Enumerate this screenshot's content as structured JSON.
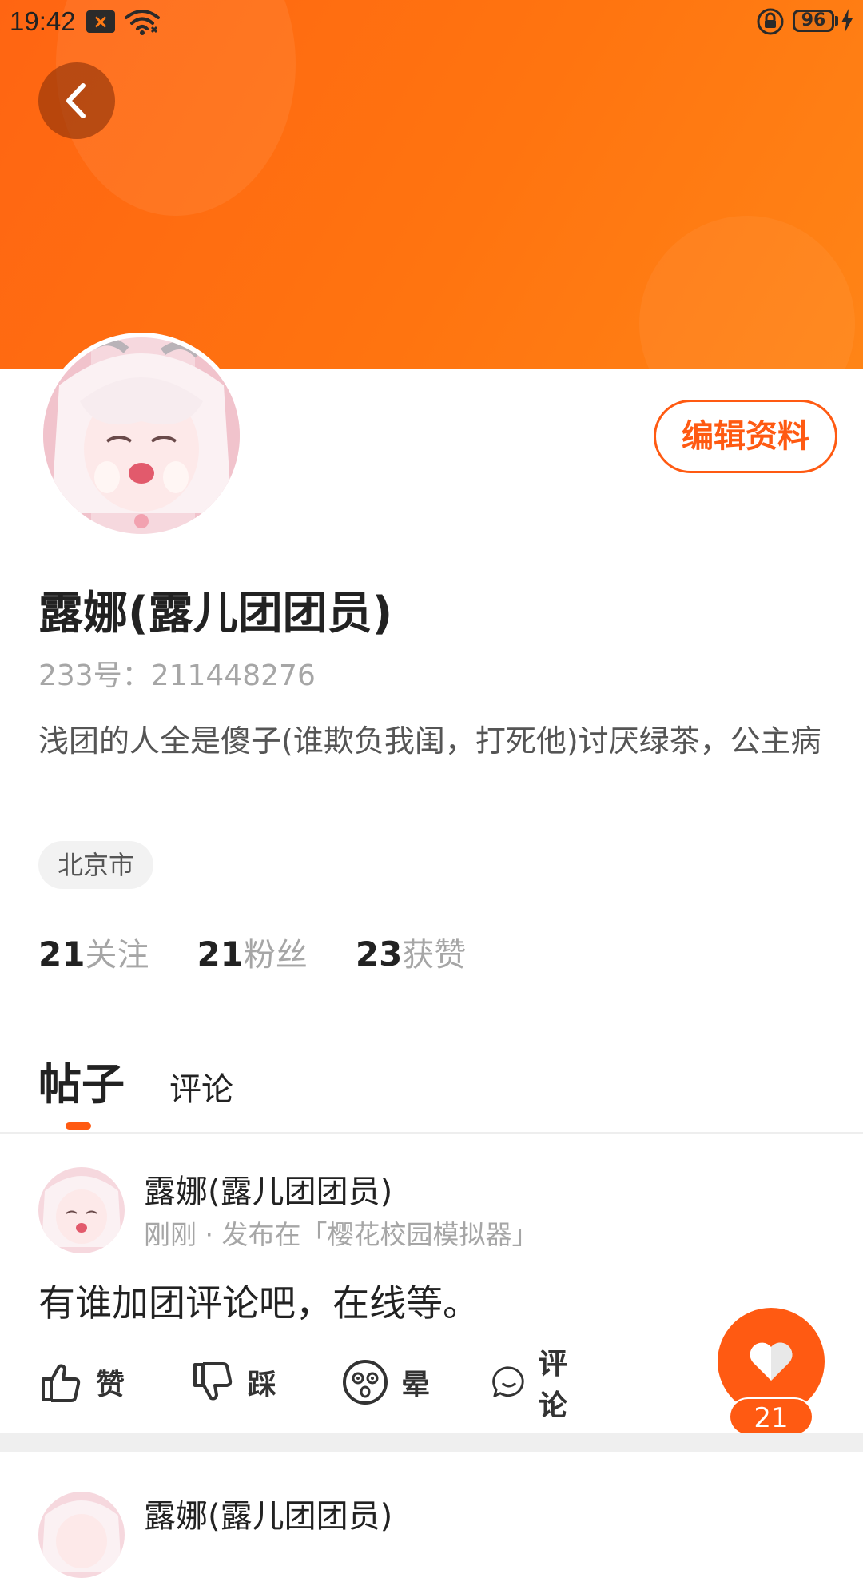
{
  "status_bar": {
    "time": "19:42",
    "battery": "96",
    "icons": [
      "notification-x-icon",
      "wifi-icon",
      "rotation-lock-icon",
      "battery-icon",
      "charging-icon"
    ]
  },
  "header": {
    "back_icon": "chevron-left-icon",
    "banner_color": "#ff7010"
  },
  "profile": {
    "edit_label": "编辑资料",
    "name": "露娜(露儿团团员)",
    "id_text": "233号：211448276",
    "bio": "浅团的人全是傻子(谁欺负我闺，打死他)讨厌绿茶，公主病",
    "location": "北京市",
    "stats": {
      "following_count": "21",
      "following_label": "关注",
      "followers_count": "21",
      "followers_label": "粉丝",
      "likes_count": "23",
      "likes_label": "获赞"
    }
  },
  "tabs": {
    "posts": "帖子",
    "comments": "评论",
    "active": "posts"
  },
  "posts": [
    {
      "author": "露娜(露儿团团员)",
      "meta": "刚刚 · 发布在「樱花校园模拟器」",
      "text": "有谁加团评论吧，在线等。",
      "actions": {
        "like": "赞",
        "dislike": "踩",
        "dizzy": "晕",
        "comment": "评论"
      }
    },
    {
      "author": "露娜(露儿团团员)"
    }
  ],
  "fab": {
    "icon": "heart-icon",
    "count": "21"
  },
  "colors": {
    "accent": "#ff5a12",
    "text": "#222222",
    "muted": "#a6a6a6"
  }
}
